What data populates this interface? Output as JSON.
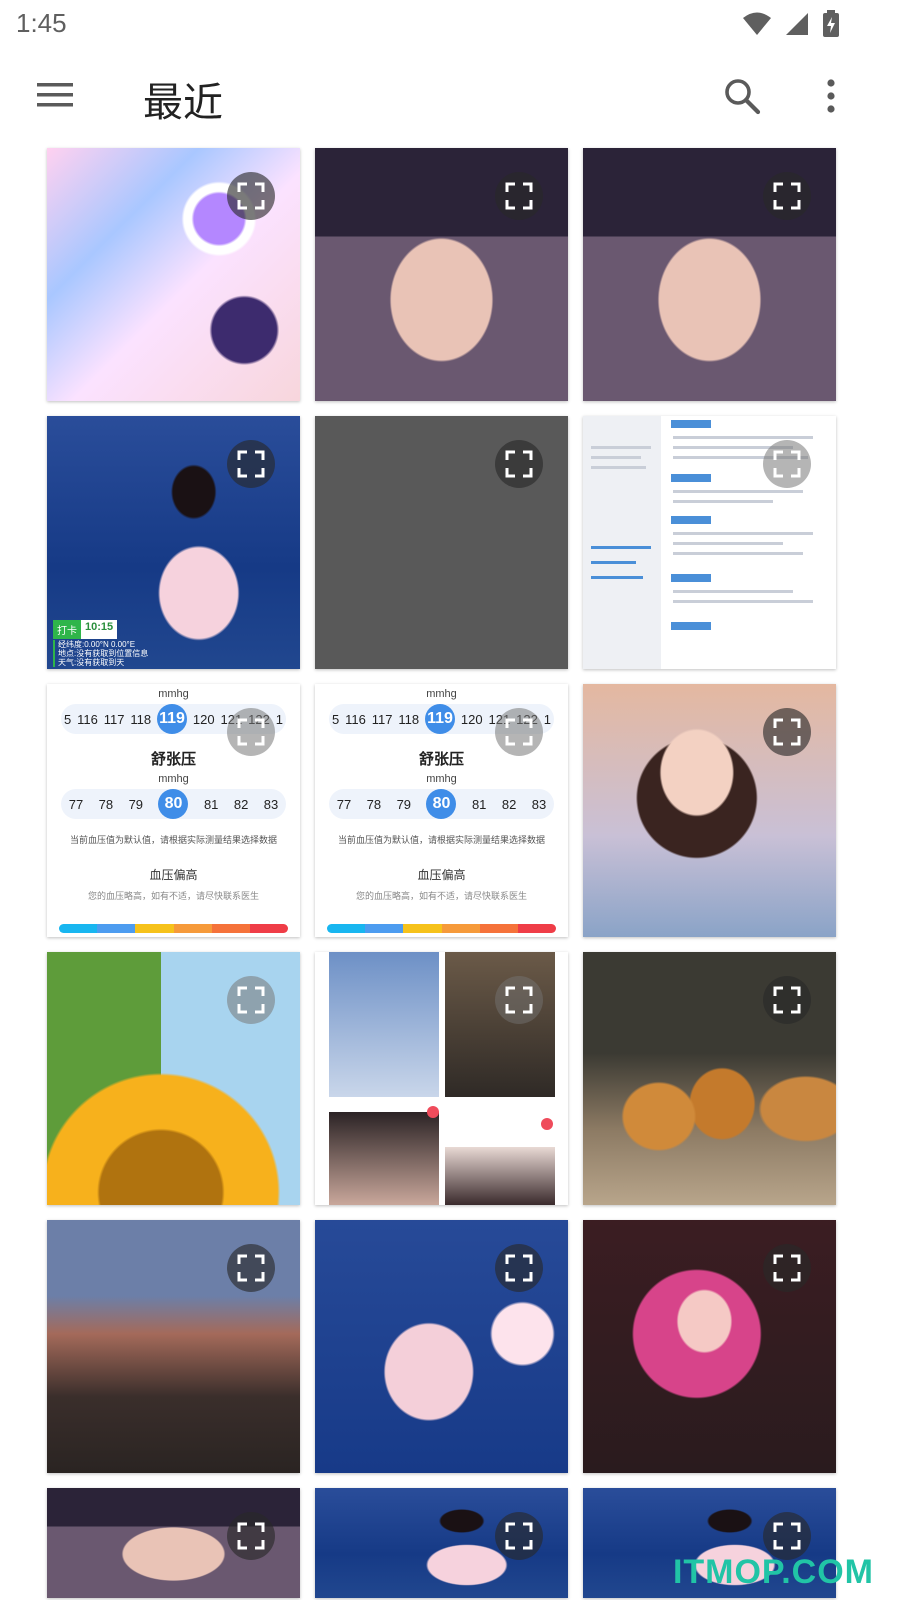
{
  "status_bar": {
    "time": "1:45"
  },
  "app_bar": {
    "title": "最近"
  },
  "tiles": [
    {
      "name": "photo-anime-girl"
    },
    {
      "name": "photo-woman-beanie"
    },
    {
      "name": "photo-woman-beanie-copy"
    },
    {
      "name": "photo-woman-sea",
      "punch_label": "打卡",
      "punch_time": "10:15",
      "overlay_lines": [
        "经纬度:0.00°N 0.00°E",
        "地点:没有获取到位置信息",
        "天气:没有获取到天"
      ]
    },
    {
      "name": "photo-gray"
    },
    {
      "name": "photo-resume"
    },
    {
      "name": "photo-bp-1"
    },
    {
      "name": "photo-bp-2"
    },
    {
      "name": "photo-girl-bears"
    },
    {
      "name": "photo-sunflower"
    },
    {
      "name": "photo-collage"
    },
    {
      "name": "photo-tigers"
    },
    {
      "name": "photo-street"
    },
    {
      "name": "photo-woman-sea-sticker"
    },
    {
      "name": "photo-pink-hair"
    }
  ],
  "bp_card": {
    "unit": "mmhg",
    "systolic_values": [
      "5",
      "116",
      "117",
      "118",
      "119",
      "120",
      "121",
      "122",
      "1"
    ],
    "systolic_selected": "119",
    "label": "舒张压",
    "diastolic_values": [
      "77",
      "78",
      "79",
      "80",
      "81",
      "82",
      "83"
    ],
    "diastolic_selected": "80",
    "note": "当前血压值为默认值，请根据实际测量结果选择数据",
    "state": "血压偏高",
    "advice": "您的血压略高，如有不适，请尽快联系医生",
    "bar_colors": [
      "#18b6f0",
      "#4d9cf0",
      "#f6c21b",
      "#f69a3a",
      "#f5723a",
      "#ef3d47"
    ]
  },
  "watermark": "ITMOP.COM",
  "colors": {
    "title": "#222222",
    "icon": "#5a5a5a",
    "accent": "#3f8de8"
  }
}
